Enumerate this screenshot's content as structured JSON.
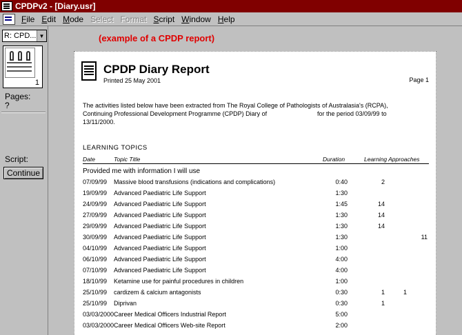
{
  "window": {
    "title": "CPDPv2 - [Diary.usr]"
  },
  "menu": {
    "items": [
      {
        "label": "File",
        "accel": "F",
        "rest": "ile",
        "enabled": true
      },
      {
        "label": "Edit",
        "accel": "E",
        "rest": "dit",
        "enabled": true
      },
      {
        "label": "Mode",
        "accel": "M",
        "rest": "ode",
        "enabled": true
      },
      {
        "label": "Select",
        "accel": "",
        "rest": "Select",
        "enabled": false
      },
      {
        "label": "Format",
        "accel": "",
        "rest": "Format",
        "enabled": false
      },
      {
        "label": "Script",
        "accel": "S",
        "rest": "cript",
        "enabled": true
      },
      {
        "label": "Window",
        "accel": "W",
        "rest": "indow",
        "enabled": true
      },
      {
        "label": "Help",
        "accel": "H",
        "rest": "elp",
        "enabled": true
      }
    ]
  },
  "sidebar": {
    "report_select": "R: CPD...",
    "thumb_page": "1",
    "pages_label": "Pages:",
    "pages_value": "?",
    "script_label": "Script:",
    "continue_label": "Continue"
  },
  "caption": "(example of a CPDP report)",
  "report": {
    "title": "CPDP Diary Report",
    "printed": "Printed 25 May 2001",
    "page_label": "Page 1",
    "intro_line1": "The activities listed below have been extracted from The Royal College of Pathologists of Australasia's (RCPA),",
    "intro_line2a": "Continuing Professional Development Programme (CPDP) Diary  of",
    "intro_line2b": "for the period 03/09/99 to",
    "intro_line3": "13/11/2000.",
    "section_title": "LEARNING TOPICS",
    "columns": {
      "date": "Date",
      "topic": "Topic Title",
      "duration": "Duration",
      "approaches": "Learning Approaches"
    },
    "group_title": "Provided me with information I will use",
    "rows": [
      {
        "date": "07/09/99",
        "topic": "Massive blood transfusions (indications and complications)",
        "duration": "0:40",
        "a1": "2",
        "a2": "",
        "a3": ""
      },
      {
        "date": "19/09/99",
        "topic": "Advanced Paediatric Life Support",
        "duration": "1:30",
        "a1": "",
        "a2": "",
        "a3": ""
      },
      {
        "date": "24/09/99",
        "topic": "Advanced Paediatric Life Support",
        "duration": "1:45",
        "a1": "14",
        "a2": "",
        "a3": ""
      },
      {
        "date": "27/09/99",
        "topic": "Advanced Paediatric Life Support",
        "duration": "1:30",
        "a1": "14",
        "a2": "",
        "a3": ""
      },
      {
        "date": "29/09/99",
        "topic": "Advanced Paediatric Life Support",
        "duration": "1:30",
        "a1": "14",
        "a2": "",
        "a3": ""
      },
      {
        "date": "30/09/99",
        "topic": "Advanced Paediatric Life Support",
        "duration": "1:30",
        "a1": "",
        "a2": "",
        "a3": "11"
      },
      {
        "date": "04/10/99",
        "topic": "Advanced Paediatric Life Support",
        "duration": "1:00",
        "a1": "",
        "a2": "",
        "a3": ""
      },
      {
        "date": "06/10/99",
        "topic": "Advanced Paediatric Life Support",
        "duration": "4:00",
        "a1": "",
        "a2": "",
        "a3": ""
      },
      {
        "date": "07/10/99",
        "topic": "Advanced Paediatric Life Support",
        "duration": "4:00",
        "a1": "",
        "a2": "",
        "a3": ""
      },
      {
        "date": "18/10/99",
        "topic": "Ketamine use for painful procedures in children",
        "duration": "1:00",
        "a1": "",
        "a2": "",
        "a3": ""
      },
      {
        "date": "25/10/99",
        "topic": "cardizem & calcium antagonists",
        "duration": "0:30",
        "a1": "1",
        "a2": "1",
        "a3": ""
      },
      {
        "date": "25/10/99",
        "topic": "Diprivan",
        "duration": "0:30",
        "a1": "1",
        "a2": "",
        "a3": ""
      },
      {
        "date": "03/03/2000",
        "topic": "Career Medical Officers Industrial Report",
        "duration": "5:00",
        "a1": "",
        "a2": "",
        "a3": ""
      },
      {
        "date": "03/03/2000",
        "topic": "Career Medical Officers Web-site Report",
        "duration": "2:00",
        "a1": "",
        "a2": "",
        "a3": ""
      }
    ]
  }
}
